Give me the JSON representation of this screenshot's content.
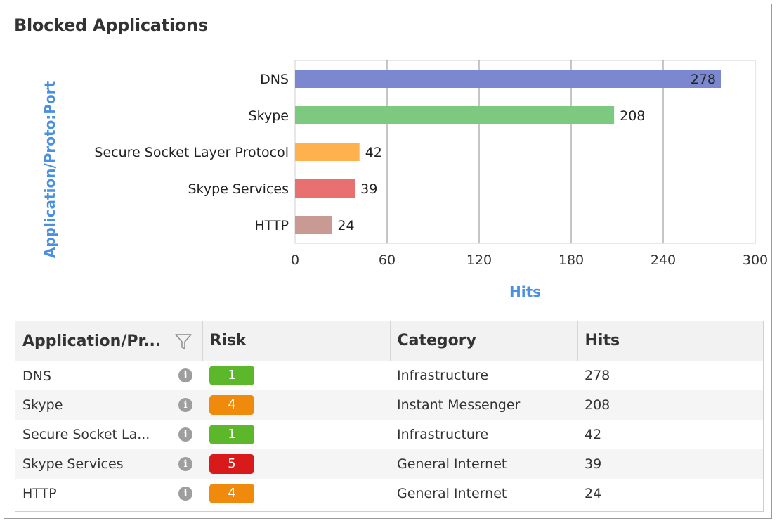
{
  "panel": {
    "title": "Blocked Applications"
  },
  "chart_data": {
    "type": "bar",
    "orientation": "horizontal",
    "categories": [
      "DNS",
      "Skype",
      "Secure Socket Layer Protocol",
      "Skype Services",
      "HTTP"
    ],
    "values": [
      278,
      208,
      42,
      39,
      24
    ],
    "colors": [
      "#7b88cf",
      "#7dc97f",
      "#ffb14e",
      "#e87070",
      "#c99a94"
    ],
    "xlabel": "Hits",
    "ylabel": "Application/Proto:Port",
    "xlim": [
      0,
      300
    ],
    "xticks": [
      "0",
      "60",
      "120",
      "180",
      "240",
      "300"
    ],
    "grid": true,
    "label_color": "#4a90e2"
  },
  "table": {
    "headers": [
      "Application/Pr...",
      "Risk",
      "Category",
      "Hits"
    ],
    "rows": [
      {
        "app": "DNS",
        "risk": "1",
        "risk_color": "#5cb82a",
        "category": "Infrastructure",
        "hits": "278"
      },
      {
        "app": "Skype",
        "risk": "4",
        "risk_color": "#ef8a0c",
        "category": "Instant Messenger",
        "hits": "208"
      },
      {
        "app": "Secure Socket La...",
        "risk": "1",
        "risk_color": "#5cb82a",
        "category": "Infrastructure",
        "hits": "42"
      },
      {
        "app": "Skype Services",
        "risk": "5",
        "risk_color": "#d91a1a",
        "category": "General Internet",
        "hits": "39"
      },
      {
        "app": "HTTP",
        "risk": "4",
        "risk_color": "#ef8a0c",
        "category": "General Internet",
        "hits": "24"
      }
    ],
    "info_icon": "info-icon",
    "filter_icon": "filter-icon"
  }
}
